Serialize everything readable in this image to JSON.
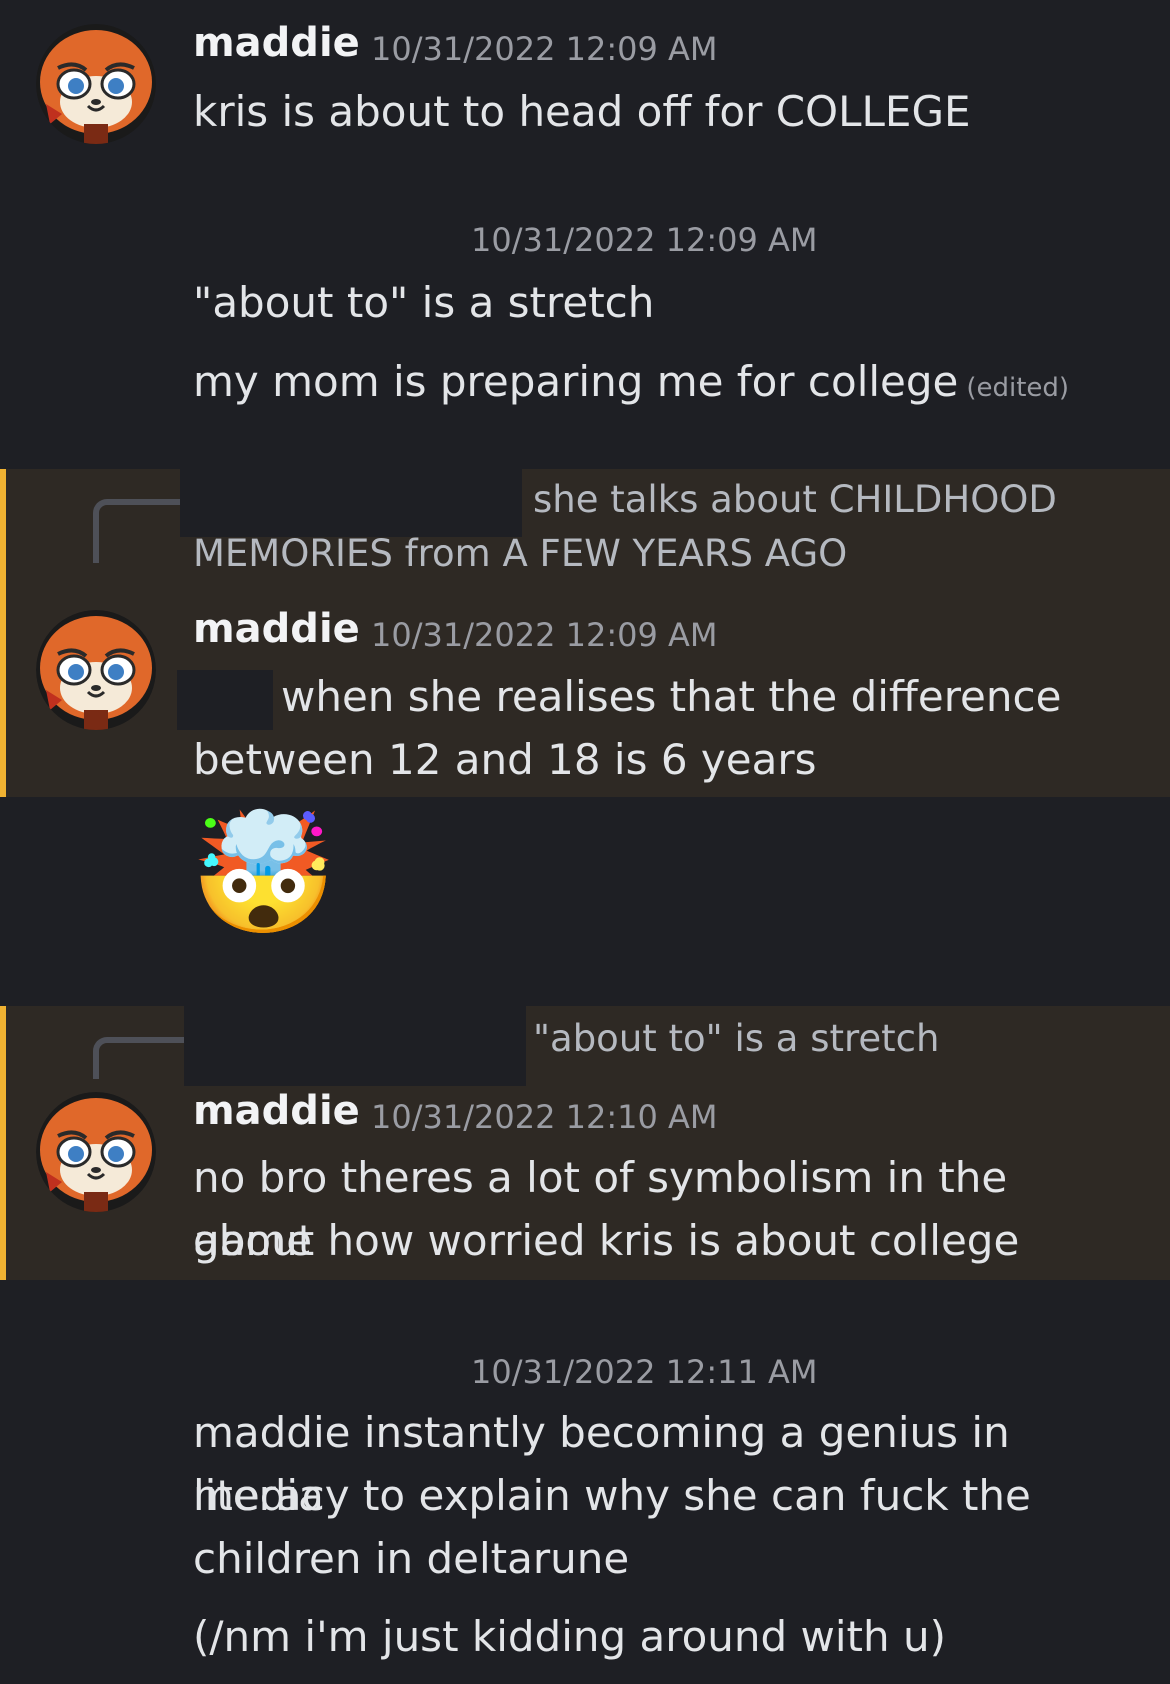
{
  "messages": {
    "m1": {
      "username": "maddie",
      "timestamp": "10/31/2022 12:09 AM",
      "text": "kris is about to head off for COLLEGE"
    },
    "m2": {
      "timestamp": "10/31/2022 12:09 AM",
      "line1": "\"about to\" is a stretch",
      "line2": "my mom is preparing me for college",
      "edited": "(edited)"
    },
    "m3": {
      "reply_line1": "she talks about CHILDHOOD",
      "reply_line2": "MEMORIES from A FEW YEARS AGO",
      "username": "maddie",
      "timestamp": "10/31/2022 12:09 AM",
      "text_line1": "when she realises that the difference",
      "text_line2": "between 12 and 18 is 6 years",
      "emoji": "🤯"
    },
    "m4": {
      "reply_text": "\"about to\" is a stretch",
      "username": "maddie",
      "timestamp": "10/31/2022 12:10 AM",
      "text_line1": "no bro theres a lot of symbolism in the game",
      "text_line2": "about how worried kris is about college"
    },
    "m5": {
      "timestamp": "10/31/2022 12:11 AM",
      "line1": "maddie instantly becoming a genius in media",
      "line2": "literacy to explain why she can fuck the",
      "line3": "children in deltarune",
      "line4": "(/nm i'm just kidding around with u)"
    }
  },
  "colors": {
    "background": "#1e1f24",
    "mention_highlight": "#2e2924",
    "mention_bar": "#f0b232"
  },
  "icons": {
    "avatar": "red-panda-avatar-icon"
  }
}
